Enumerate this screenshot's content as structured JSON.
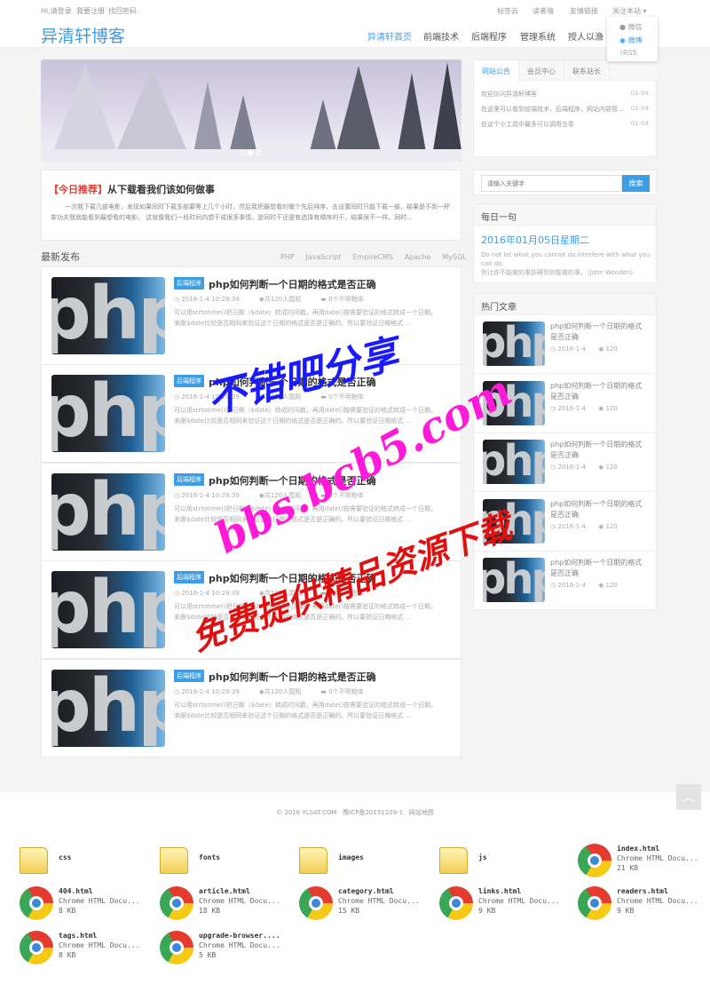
{
  "topbar": {
    "login": "Hi,请登录",
    "register": "我要注册",
    "forgot": "找回密码",
    "links": [
      "标签云",
      "读者墙",
      "友情链接",
      "关注本站 ▾"
    ]
  },
  "dropdown": [
    "微信",
    "微博",
    "RSS"
  ],
  "logo": "异清轩博客",
  "nav": [
    "异清轩首页",
    "前端技术",
    "后端程序",
    "管理系统",
    "授人以渔"
  ],
  "recommend": {
    "tag": "【今日推荐】",
    "title": "从下载看我们该如何做事",
    "body": "一次我下载几部电影，发现如果同时下载多部要等上几个小时，然后我把最想看的做个先后排序，去设置同时只能下载一部，结果是不到一杯茶功夫我就能看到最想看的电影。 这就像我们一段时间内想干成很多事情，是同时干还是有选择有顺序的干，结果很不一样。同时..."
  },
  "latest": {
    "heading": "最新发布",
    "tags": [
      "PHP",
      "JavaScript",
      "EmpireCMS",
      "Apache",
      "MySQL"
    ]
  },
  "articles": [
    {
      "badge": "后端程序",
      "title": "php如何判断一个日期的格式是否正确",
      "date": "2016-1-4 10:29:39",
      "views": "共120人围观",
      "comments": "0个不明物体",
      "desc": "可以用strtotime()把日期（$date）转成时间戳，再用date()按需要验证的格式转成一个日期，来跟$date比较是否相同来验证这个日期的格式是否是正确的。所以要验证日期格式 ..."
    },
    {
      "badge": "后端程序",
      "title": "php如何判断一个日期的格式是否正确",
      "date": "2016-1-4 10:29:39",
      "views": "共120人围观",
      "comments": "0个不明物体",
      "desc": "可以用strtotime()把日期（$date）转成时间戳，再用date()按需要验证的格式转成一个日期，来跟$date比较是否相同来验证这个日期的格式是否是正确的。所以要验证日期格式 ..."
    },
    {
      "badge": "后端程序",
      "title": "php如何判断一个日期的格式是否正确",
      "date": "2016-1-4 10:29:39",
      "views": "共120人围观",
      "comments": "0个不明物体",
      "desc": "可以用strtotime()把日期（$date）转成时间戳，再用date()按需要验证的格式转成一个日期，来跟$date比较是否相同来验证这个日期的格式是否是正确的。所以要验证日期格式 ..."
    },
    {
      "badge": "后端程序",
      "title": "php如何判断一个日期的格式是否正确",
      "date": "2016-1-4 10:29:39",
      "views": "共120人围观",
      "comments": "0个不明物体",
      "desc": "可以用strtotime()把日期（$date）转成时间戳，再用date()按需要验证的格式转成一个日期，来跟$date比较是否相同来验证这个日期的格式是否是正确的。所以要验证日期格式 ..."
    },
    {
      "badge": "后端程序",
      "title": "php如何判断一个日期的格式是否正确",
      "date": "2016-1-4 10:29:39",
      "views": "共120人围观",
      "comments": "0个不明物体",
      "desc": "可以用strtotime()把日期（$date）转成时间戳，再用date()按需要验证的格式转成一个日期，来跟$date比较是否相同来验证这个日期的格式是否是正确的。所以要验证日期格式 ..."
    }
  ],
  "notice": {
    "tabs": [
      "网站公告",
      "会员中心",
      "联系站长"
    ],
    "items": [
      {
        "text": "欢迎访问异清轩博客",
        "date": "01-04"
      },
      {
        "text": "在这里可以看到前端技术，后端程序，网站内容管...",
        "date": "01-04"
      },
      {
        "text": "在这个小工具中最多可以调用五条",
        "date": "01-04"
      }
    ]
  },
  "search": {
    "placeholder": "请输入关键字",
    "button": "搜索"
  },
  "daily": {
    "heading": "每日一句",
    "date": "2016年01月05日星期二",
    "en": "Do not let what you cannot do interfere with what you can do.",
    "zh": "别让你不能做的事妨碍到你能做的事。（John Wooden）"
  },
  "hot": {
    "heading": "热门文章",
    "items": [
      {
        "title": "php如何判断一个日期的格式是否正确",
        "date": "2016-1-4",
        "views": "120"
      },
      {
        "title": "php如何判断一个日期的格式是否正确",
        "date": "2016-1-4",
        "views": "120"
      },
      {
        "title": "php如何判断一个日期的格式是否正确",
        "date": "2016-1-4",
        "views": "120"
      },
      {
        "title": "php如何判断一个日期的格式是否正确",
        "date": "2016-1-4",
        "views": "120"
      },
      {
        "title": "php如何判断一个日期的格式是否正确",
        "date": "2016-1-4",
        "views": "120"
      }
    ]
  },
  "footer": {
    "copyright": "© 2016 YLSAT.COM",
    "icp": "豫ICP备20151109-1",
    "sitemap": "网站地图"
  },
  "thumb_text": "php",
  "files": [
    {
      "name": "css",
      "kind": "folder"
    },
    {
      "name": "fonts",
      "kind": "folder"
    },
    {
      "name": "images",
      "kind": "folder"
    },
    {
      "name": "js",
      "kind": "folder"
    },
    {
      "name": "index.html",
      "type": "Chrome HTML Docu...",
      "size": "21 KB",
      "kind": "chrome"
    },
    {
      "name": "404.html",
      "type": "Chrome HTML Docu...",
      "size": "8 KB",
      "kind": "chrome"
    },
    {
      "name": "article.html",
      "type": "Chrome HTML Docu...",
      "size": "18 KB",
      "kind": "chrome"
    },
    {
      "name": "category.html",
      "type": "Chrome HTML Docu...",
      "size": "15 KB",
      "kind": "chrome"
    },
    {
      "name": "links.html",
      "type": "Chrome HTML Docu...",
      "size": "9 KB",
      "kind": "chrome"
    },
    {
      "name": "readers.html",
      "type": "Chrome HTML Docu...",
      "size": "9 KB",
      "kind": "chrome"
    },
    {
      "name": "tags.html",
      "type": "Chrome HTML Docu...",
      "size": "8 KB",
      "kind": "chrome"
    },
    {
      "name": "upgrade-browser....",
      "type": "Chrome HTML Docu...",
      "size": "5 KB",
      "kind": "chrome"
    }
  ],
  "watermark": [
    "不错吧分享",
    "bbs.bcb5.com",
    "免费提供精品资源下载"
  ],
  "colors": {
    "accent": "#3d9ee5",
    "recommend_tag": "#e33b2e",
    "watermark_blue": "#1a1aff",
    "watermark_magenta": "#ff19d9",
    "watermark_red": "#e01010"
  }
}
